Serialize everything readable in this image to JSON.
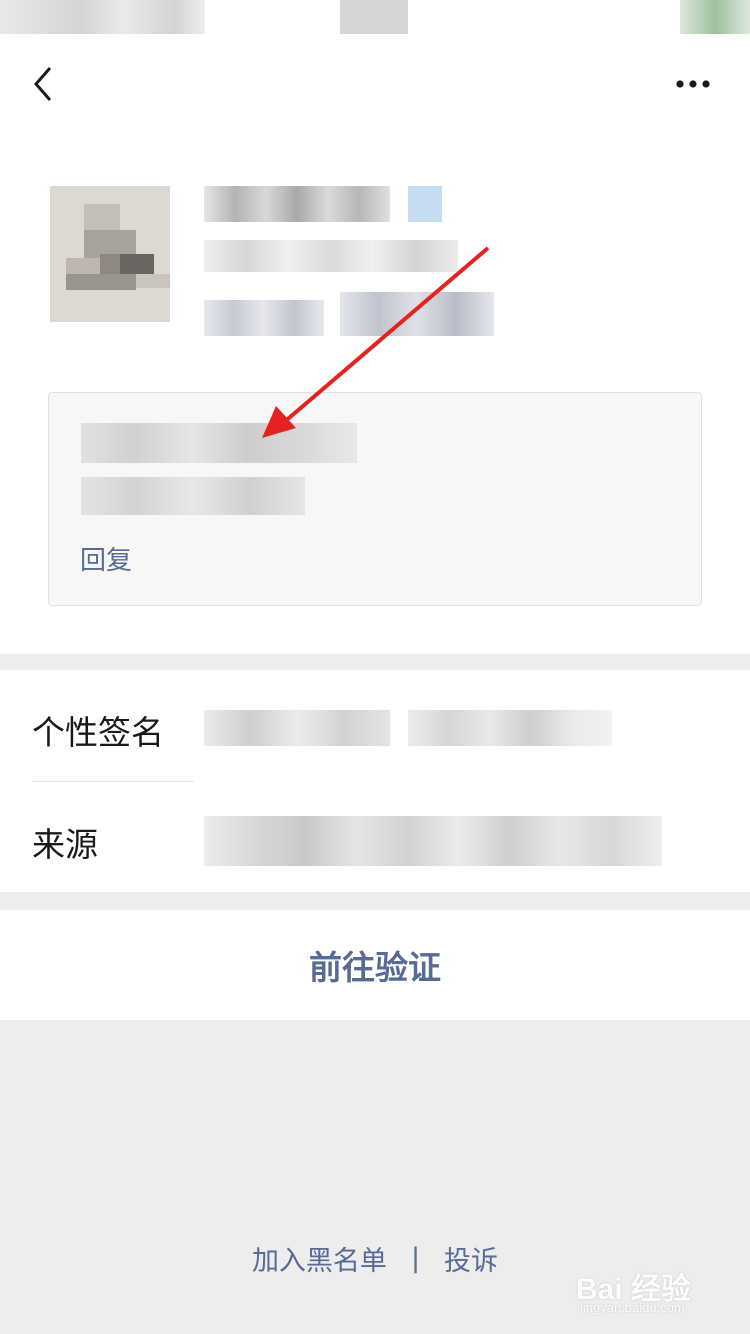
{
  "card": {
    "reply_label": "回复"
  },
  "profile_rows": [
    {
      "label": "个性签名"
    },
    {
      "label": "来源"
    }
  ],
  "actions": {
    "verify_label": "前往验证"
  },
  "footer": {
    "blacklist_label": "加入黑名单",
    "separator": "|",
    "report_label": "投诉"
  },
  "watermark": {
    "main": "Bai 经验",
    "sub": "jingyan.baidu.com"
  },
  "icons": {
    "back": "chevron-left-icon",
    "more": "more-dots-icon"
  },
  "colors": {
    "link": "#576b95",
    "annotation_arrow": "#e52222",
    "background": "#ededed"
  }
}
